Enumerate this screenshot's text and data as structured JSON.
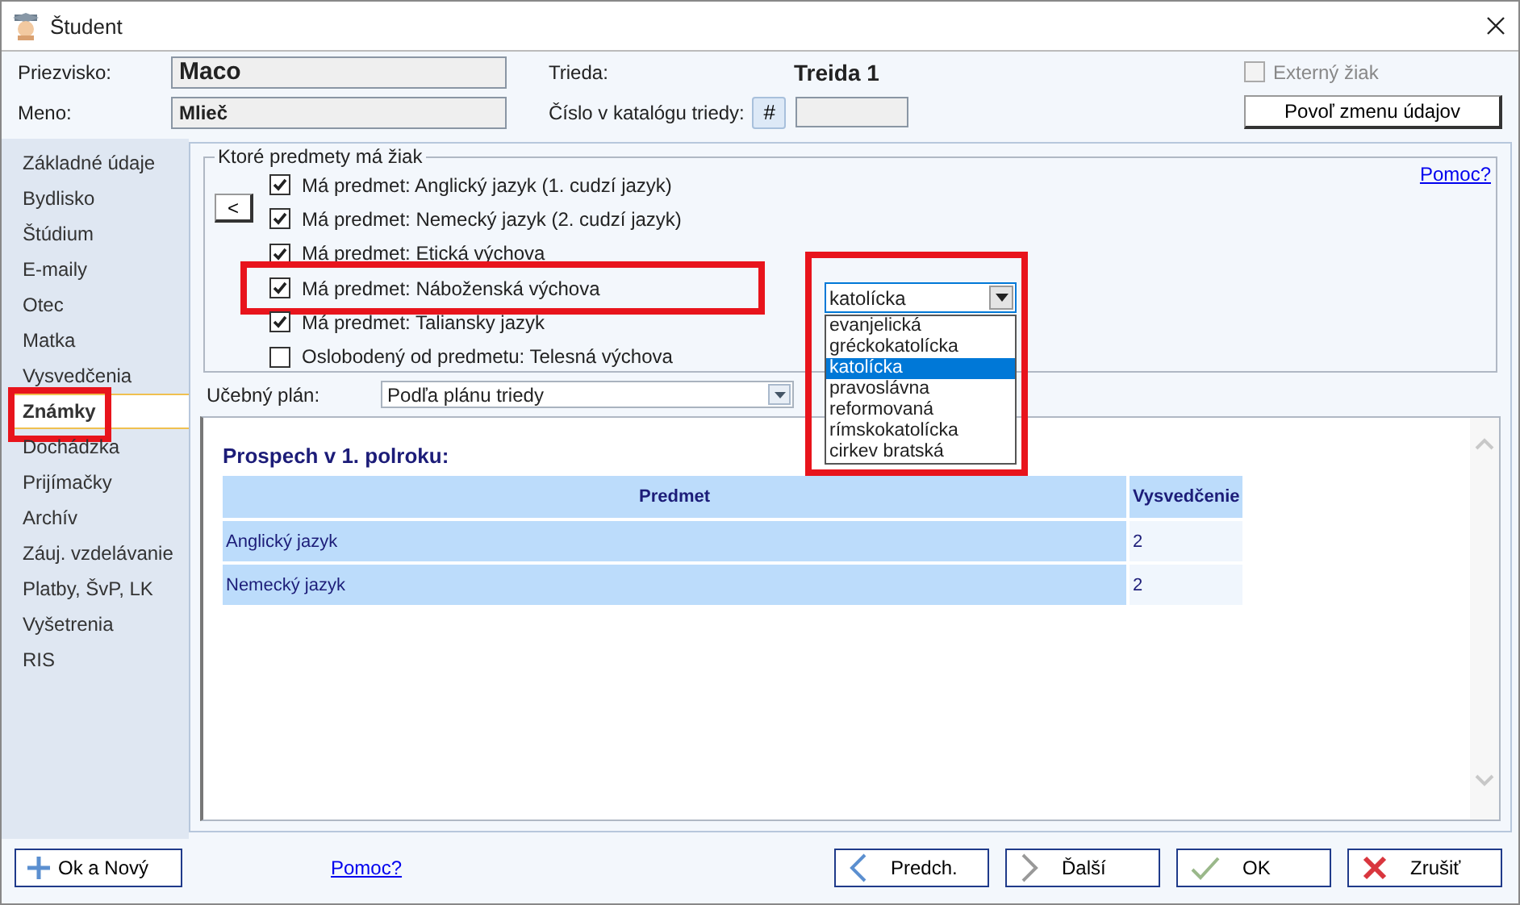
{
  "window": {
    "title": "Študent"
  },
  "header": {
    "surname_label": "Priezvisko:",
    "surname": "Maco",
    "name_label": "Meno:",
    "name": "Mlieč",
    "class_label": "Trieda:",
    "class": "Treida 1",
    "catalog_label": "Číslo v katalógu triedy:",
    "catalog_button": "#",
    "external": {
      "label": "Externý žiak",
      "checked": false,
      "disabled": true
    },
    "allow_change_button": "Povoľ zmenu údajov"
  },
  "sidebar": {
    "items": [
      {
        "label": "Základné údaje",
        "selected": false
      },
      {
        "label": "Bydlisko",
        "selected": false
      },
      {
        "label": "Štúdium",
        "selected": false
      },
      {
        "label": "E-maily",
        "selected": false
      },
      {
        "label": "Otec",
        "selected": false
      },
      {
        "label": "Matka",
        "selected": false
      },
      {
        "label": "Vysvedčenia",
        "selected": false
      },
      {
        "label": "Známky",
        "selected": true
      },
      {
        "label": "Dochádzka",
        "selected": false
      },
      {
        "label": "Prijímačky",
        "selected": false
      },
      {
        "label": "Archív",
        "selected": false
      },
      {
        "label": "Záuj. vzdelávanie",
        "selected": false
      },
      {
        "label": "Platby, ŠvP, LK",
        "selected": false
      },
      {
        "label": "Vyšetrenia",
        "selected": false
      },
      {
        "label": "RIS",
        "selected": false
      }
    ]
  },
  "subjects": {
    "title": "Ktoré predmety má žiak",
    "back_button": "<",
    "help_link": "Pomoc?",
    "items": [
      {
        "label": "Má predmet: Anglický jazyk (1. cudzí jazyk)",
        "checked": true
      },
      {
        "label": "Má predmet: Nemecký jazyk (2. cudzí jazyk)",
        "checked": true
      },
      {
        "label": "Má predmet: Etická výchova",
        "checked": true
      },
      {
        "label": "Má predmet: Náboženská výchova",
        "checked": true
      },
      {
        "label": "Má predmet: Taliansky jazyk",
        "checked": true
      },
      {
        "label": "Oslobodený od predmetu: Telesná výchova",
        "checked": false
      }
    ]
  },
  "religion_dropdown": {
    "value": "katolícka",
    "expanded": true,
    "options": [
      {
        "label": "evanjelická",
        "selected": false
      },
      {
        "label": "gréckokatolícka",
        "selected": false
      },
      {
        "label": "katolícka",
        "selected": true
      },
      {
        "label": "pravoslávna",
        "selected": false
      },
      {
        "label": "reformovaná",
        "selected": false
      },
      {
        "label": "rímskokatolícka",
        "selected": false
      },
      {
        "label": "cirkev bratská",
        "selected": false
      }
    ]
  },
  "study_plan": {
    "label": "Učebný plán:",
    "value": "Podľa plánu triedy"
  },
  "grades": {
    "title": "Prospech v 1. polroku:",
    "columns": [
      "Predmet",
      "Vysvedčenie"
    ],
    "rows": [
      [
        "Anglický jazyk",
        "2"
      ],
      [
        "Nemecký jazyk",
        "2"
      ]
    ]
  },
  "footer": {
    "ok_new": "Ok a Nový",
    "help_link": "Pomoc?",
    "prev": "Predch.",
    "next": "Ďalší",
    "ok": "OK",
    "cancel": "Zrušiť"
  }
}
